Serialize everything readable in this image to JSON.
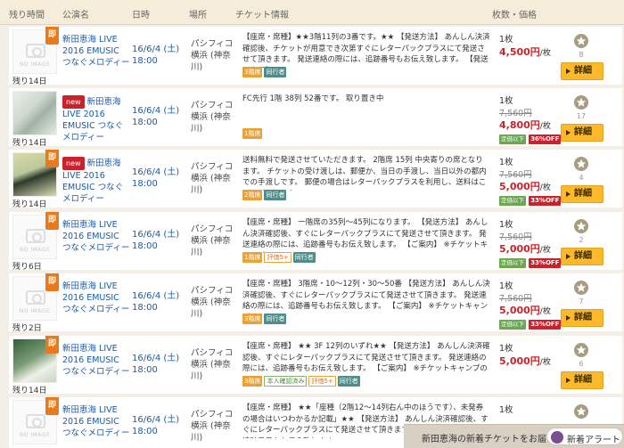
{
  "header": {
    "remain": "残り時間",
    "event": "公演名",
    "date": "日時",
    "venue": "場所",
    "ticket": "チケット情報",
    "price": "枚数・価格"
  },
  "rows": [
    {
      "remain": "残り14日",
      "soku": "即",
      "thumb": "NO IMAGE",
      "new": "",
      "name": "新田恵海 LIVE 2016 EMUSIC つなぐメロディー",
      "date": "16/6/4 (土) 18:00",
      "venue": "パシフィコ横浜 (神奈川)",
      "info": "【座席・席種】★★3階11列の3番です。★★ 【発送方法】 あんしん決済確認後、チケットが用意でき次第すぐにレターパックプラスにて発送させて頂きます。 発送連絡の際には、追跡番号もお伝え致します。 【発送予定日】",
      "tags": [
        "3階席",
        "同行者"
      ],
      "qty": "1枚",
      "orig": "",
      "price": "4,500円",
      "per": "/枚",
      "disc1": "",
      "disc2": "",
      "fav": "8",
      "detail": "詳細"
    },
    {
      "remain": "残り14日",
      "soku": "",
      "thumb": "",
      "new": "new",
      "name": "新田恵海 LIVE 2016 EMUSIC つなぐメロディー",
      "date": "16/6/4 (土) 18:00",
      "venue": "パシフィコ横浜 (神奈川)",
      "info": "FC先行 1階 38列 52番です。 取り置き中",
      "tags": [
        "1階席"
      ],
      "qty": "1枚",
      "orig": "7,560円",
      "price": "4,800円",
      "per": "/枚",
      "disc1": "定価以下",
      "disc2": "36%OFF",
      "fav": "17",
      "detail": "詳細"
    },
    {
      "remain": "残り14日",
      "soku": "即",
      "thumb": "",
      "new": "new",
      "name": "新田恵海 LIVE 2016 EMUSIC つなぐメロディー",
      "date": "16/6/4 (土) 18:00",
      "venue": "パシフィコ横浜 (神奈川)",
      "info": "送料無料で発送させていただきます。 2階席 15列 中央寄りの席となります。 チケットの受け渡しは、郵便か、当日の手渡し、当日以外の都内での手渡しです。 郵便の場合はレターパックプラスを利用し、送料はこちらが負担いた...",
      "tags": [
        "2階席",
        "同行者"
      ],
      "qty": "1枚",
      "orig": "7,560円",
      "price": "5,000円",
      "per": "/枚",
      "disc1": "定価以下",
      "disc2": "33%OFF",
      "fav": "4",
      "detail": "詳細"
    },
    {
      "remain": "残り6日",
      "soku": "即",
      "thumb": "NO IMAGE",
      "new": "",
      "name": "新田恵海 LIVE 2016 EMUSIC つなぐメロディー",
      "date": "16/6/4 (土) 18:00",
      "venue": "パシフィコ横浜 (神奈川)",
      "info": "【座席・席種】 一階席の35列〜45列になります。 【発送方法】 あんしん決済確認後、すぐにレターパックプラスにて発送させて頂きます。 発送連絡の際には、追跡番号もお伝え致します。 【ご案内】 ※チケットキャンプのルー...",
      "tags": [
        "1階席",
        "評価5+",
        "同行者"
      ],
      "qty": "1枚",
      "orig": "7,560円",
      "price": "5,000円",
      "per": "/枚",
      "disc1": "定価以下",
      "disc2": "33%OFF",
      "fav": "2",
      "detail": "詳細"
    },
    {
      "remain": "残り2日",
      "soku": "即",
      "thumb": "NO IMAGE",
      "new": "",
      "name": "新田恵海 LIVE 2016 EMUSIC つなぐメロディー",
      "date": "16/6/4 (土) 18:00",
      "venue": "パシフィコ横浜 (神奈川)",
      "info": "【座席・席種】 3階席・10〜12列・30〜50番 【発送方法】 あんしん決済確認後、すぐにレターパックプラスにて発送させて頂きます。 発送連絡の際には、追跡番号もお伝え致します。 【ご案内】 ※チケットキャンプのル...",
      "tags": [
        "3階席",
        "同行者"
      ],
      "qty": "1枚",
      "orig": "7,560円",
      "price": "5,000円",
      "per": "/枚",
      "disc1": "定価以下",
      "disc2": "33%OFF",
      "fav": "7",
      "detail": "詳細"
    },
    {
      "remain": "残り14日",
      "soku": "即",
      "thumb": "",
      "new": "",
      "name": "新田恵海 LIVE 2016 EMUSIC つなぐメロディー",
      "date": "16/6/4 (土) 18:00",
      "venue": "パシフィコ横浜 (神奈川)",
      "info": "【座席・席種】 ★★ 3F 12列のいずれ★★ 【発送方法】 あんしん決済確認後、すぐにレターパックプラスにて発送させて頂きます。 発送連絡の際には、追跡番号もお伝え致します。 【ご案内】 ※チケットキャンプのルール...",
      "tags": [
        "3階席",
        "本人確認済み",
        "評価5+",
        "同行者"
      ],
      "qty": "1枚",
      "orig": "",
      "price": "5,000円",
      "per": "/枚",
      "disc1": "",
      "disc2": "",
      "fav": "6",
      "detail": "詳細"
    },
    {
      "remain": "",
      "soku": "即",
      "thumb": "NO IMAGE",
      "new": "",
      "name": "新田恵海 LIVE 2016 EMUSIC つなぐメロディー",
      "date": "16/6/4 (土) 18:00",
      "venue": "パシフィコ横浜 (神奈川)",
      "info": "【座席・席種】 ★★「座種（2階12〜14列右ん中のほうです）、未発券の場合はいつわかるか記載」★★ 【発送方法】 あんしん決済確認後、すぐにレターパックプラスにて発送させて頂きます。 発送連絡の際には、追跡番号もお伝え致します。",
      "tags": [],
      "qty": "1枚",
      "orig": "",
      "price": "",
      "per": "",
      "disc1": "",
      "disc2": "",
      "fav": "",
      "detail": ""
    }
  ],
  "alert": {
    "text": "新田恵海の新着チケットをお届け",
    "button": "新着アラート"
  },
  "colors": {
    "accent": "#fbb92b",
    "price": "#c8232c",
    "link": "#1a5aa8",
    "badge_orange": "#e87a1d"
  }
}
